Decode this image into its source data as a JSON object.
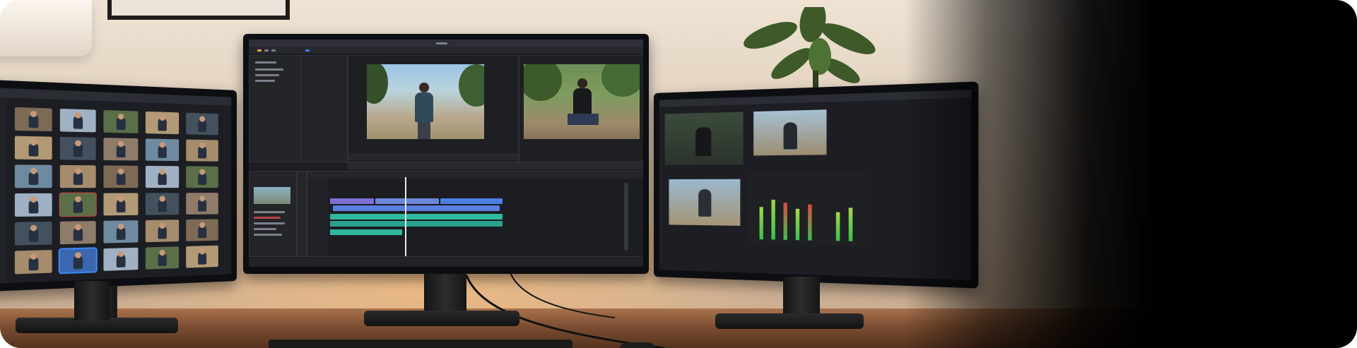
{
  "scene": {
    "description_tags": [
      "video-editing-workstation"
    ],
    "colors": {
      "wall": "#e5d6c4",
      "desk": "#8a5a38",
      "screen_bg": "#1c1e23",
      "timeline_purple": "#7b6fd6",
      "timeline_blue": "#4d7fe6",
      "timeline_teal": "#2fb8a0",
      "playhead": "#e8e8e8"
    }
  },
  "left_monitor": {
    "thumbnail_rows": 6,
    "thumbnail_cols": 5,
    "selected_thumbnail": "row-6-col-2"
  },
  "center_monitor": {
    "program_monitor": "person-standing-park",
    "source_monitor": "person-sitting-park",
    "timeline_tracks": [
      "video-1",
      "video-2",
      "audio-1",
      "audio-2"
    ]
  },
  "right_monitor": {
    "panels": [
      "source",
      "program",
      "audio-mixer"
    ]
  },
  "icons": {
    "plant": "plant-icon",
    "lamp": "lamp-icon",
    "keyboard": "keyboard-icon",
    "mouse": "mouse-icon",
    "playhead": "playhead-icon"
  }
}
